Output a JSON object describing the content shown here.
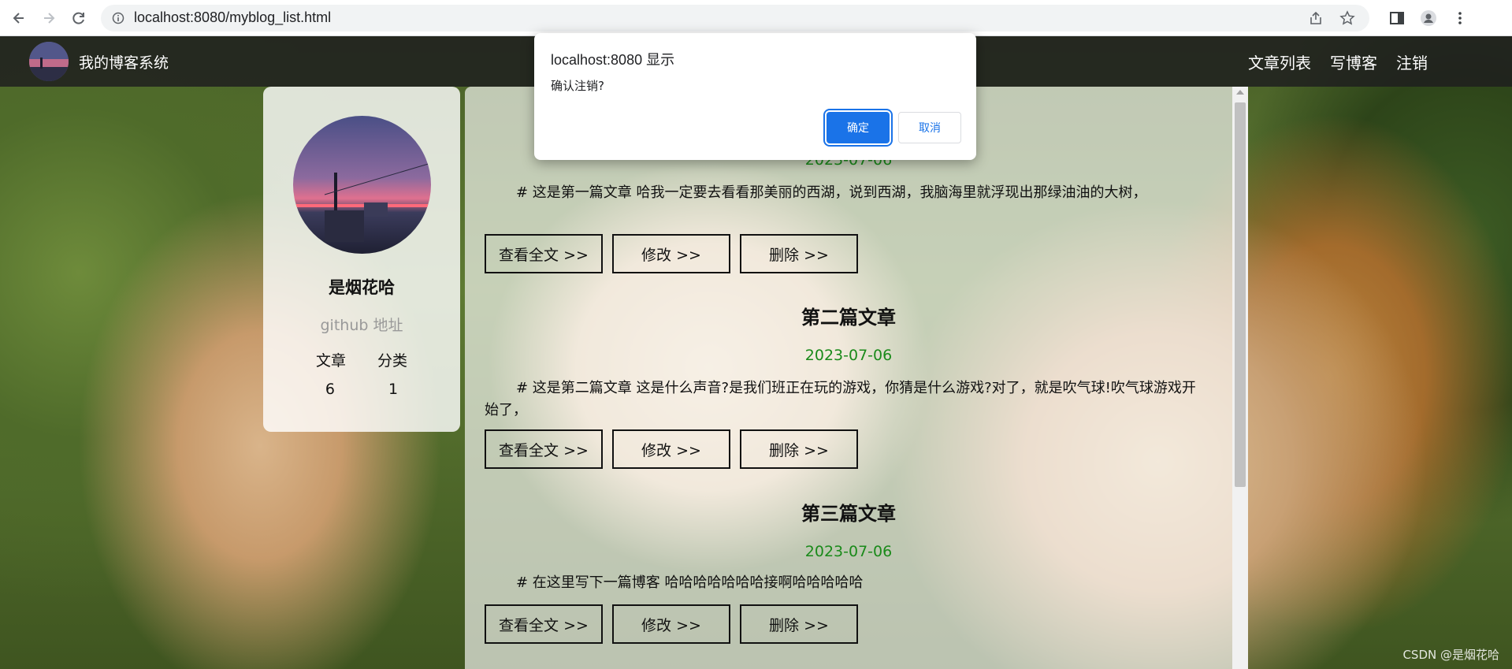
{
  "browser": {
    "url": "localhost:8080/myblog_list.html"
  },
  "navbar": {
    "site_title": "我的博客系统",
    "links": [
      "文章列表",
      "写博客",
      "注销"
    ]
  },
  "profile": {
    "name": "是烟花哈",
    "github": "github 地址",
    "stat_labels": [
      "文章",
      "分类"
    ],
    "stat_values": [
      "6",
      "1"
    ]
  },
  "articles": [
    {
      "title": "",
      "date": "2023-07-06",
      "desc": "# 这是第一篇文章 哈我一定要去看看那美丽的西湖，说到西湖，我脑海里就浮现出那绿油油的大树，"
    },
    {
      "title": "第二篇文章",
      "date": "2023-07-06",
      "desc": "# 这是第二篇文章 这是什么声音?是我们班正在玩的游戏，你猜是什么游戏?对了，就是吹气球!吹气球游戏开始了，"
    },
    {
      "title": "第三篇文章",
      "date": "2023-07-06",
      "desc": "# 在这里写下一篇博客 哈哈哈哈哈哈哈接啊哈哈哈哈哈"
    }
  ],
  "buttons": {
    "view": "查看全文 >>",
    "edit": "修改 >>",
    "delete": "删除 >>"
  },
  "dialog": {
    "title": "localhost:8080 显示",
    "message": "确认注销?",
    "ok": "确定",
    "cancel": "取消"
  },
  "watermark": "CSDN @是烟花哈",
  "colors": {
    "date_green": "#1a8a1a",
    "dialog_ok_blue": "#1a73e8",
    "navbar_bg": "#1e1e1e"
  }
}
